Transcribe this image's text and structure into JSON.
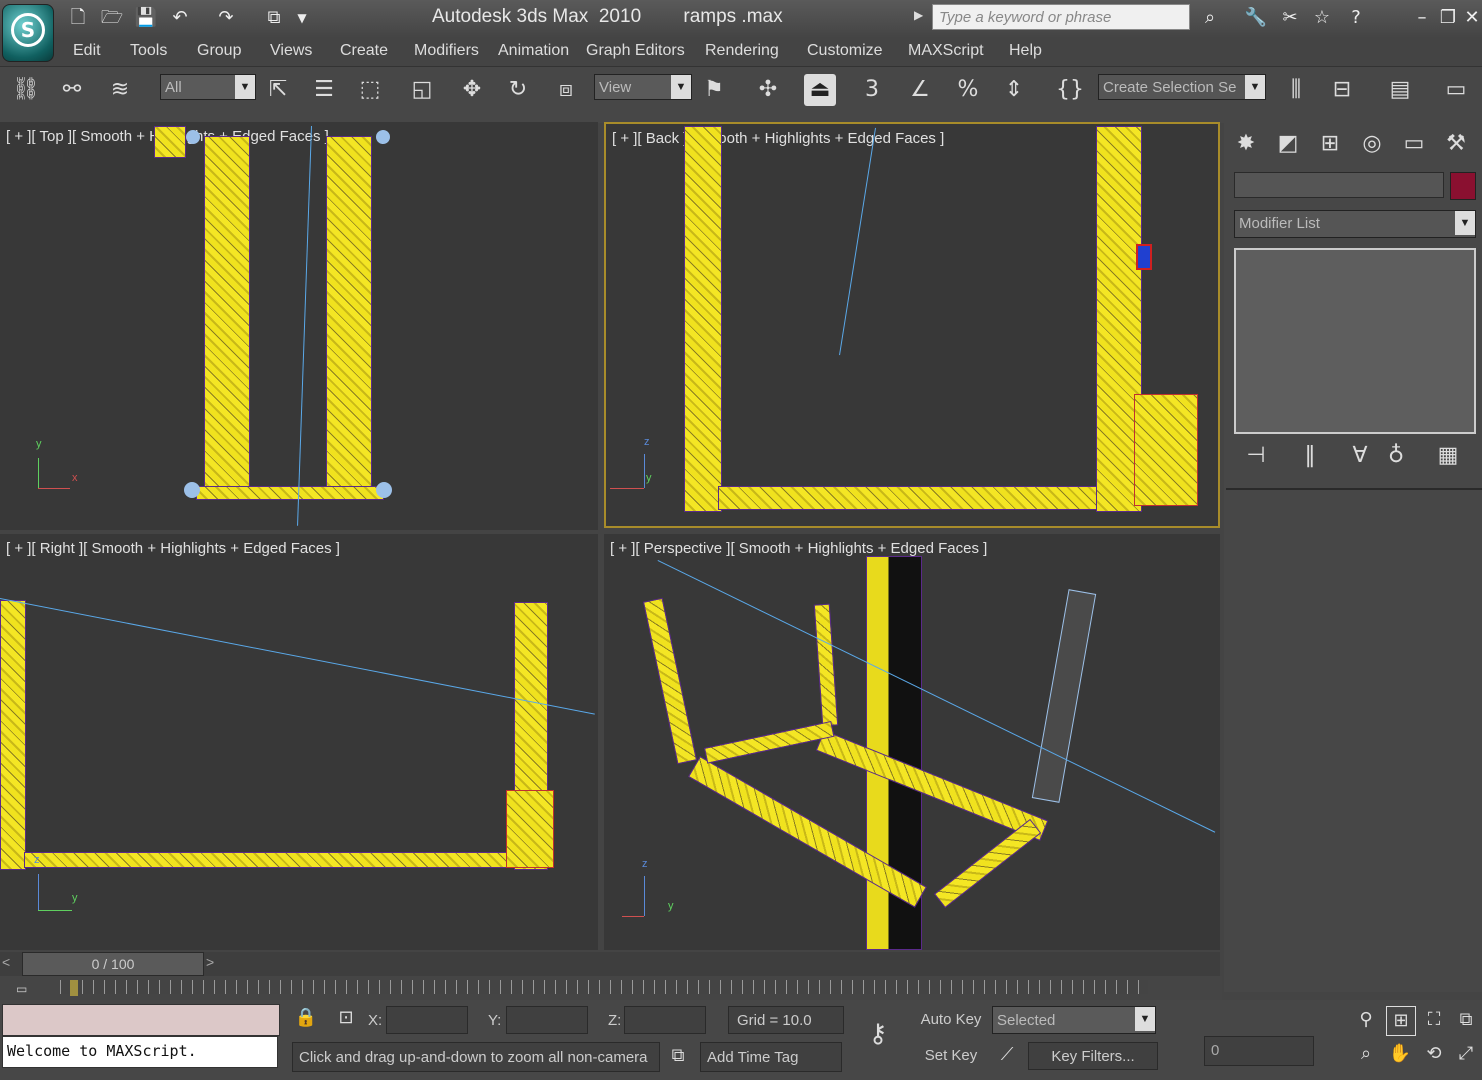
{
  "app": {
    "title": "Autodesk 3ds Max  2010        ramps .max",
    "search_placeholder": "Type a keyword or phrase"
  },
  "menu": [
    "Edit",
    "Tools",
    "Group",
    "Views",
    "Create",
    "Modifiers",
    "Animation",
    "Graph Editors",
    "Rendering",
    "Customize",
    "MAXScript",
    "Help"
  ],
  "toolbar": {
    "filter_value": "All",
    "refcoord_value": "View",
    "selection_set_value": "Create Selection Se",
    "snap_3d_label": "3"
  },
  "viewports": {
    "top": "[ + ][ Top ][ Smooth + Highlights + Edged Faces ]",
    "back": "[ + ][ Back ][ Smooth + Highlights + Edged Faces ]",
    "right": "[ + ][ Right ][ Smooth + Highlights + Edged Faces ]",
    "perspective": "[ + ][ Perspective ][ Smooth + Highlights + Edged Faces ]"
  },
  "axes": {
    "x": "x",
    "y": "y",
    "z": "z"
  },
  "command_panel": {
    "modifier_list": "Modifier List",
    "object_color": "#8a1030"
  },
  "time": {
    "slider_label": "0 / 100",
    "prev": "<",
    "next": ">"
  },
  "status": {
    "maxscript_output": "Welcome to MAXScript.",
    "prompt": "Click and drag up-and-down to zoom all non-camera",
    "x_label": "X:",
    "y_label": "Y:",
    "z_label": "Z:",
    "grid": "Grid = 10.0",
    "add_time_tag": "Add Time Tag",
    "auto_key": "Auto Key",
    "set_key": "Set Key",
    "selected": "Selected",
    "key_filters": "Key Filters...",
    "frame_value": "0"
  }
}
